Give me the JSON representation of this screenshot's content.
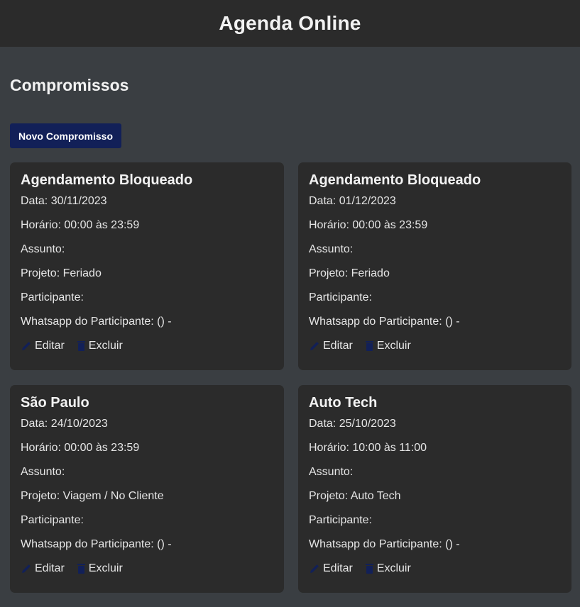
{
  "header": {
    "title": "Agenda Online"
  },
  "page": {
    "title": "Compromissos",
    "new_button": "Novo Compromisso"
  },
  "labels": {
    "edit": "Editar",
    "delete": "Excluir"
  },
  "icons": {
    "edit": "pencil-icon",
    "delete": "trash-icon",
    "icon_color": "#122058"
  },
  "cards": [
    {
      "title": "Agendamento Bloqueado",
      "data": "Data: 30/11/2023",
      "horario": "Horário: 00:00 às 23:59",
      "assunto": "Assunto:",
      "projeto": "Projeto: Feriado",
      "participante": "Participante:",
      "whatsapp": "Whatsapp do Participante: () -"
    },
    {
      "title": "Agendamento Bloqueado",
      "data": "Data: 01/12/2023",
      "horario": "Horário: 00:00 às 23:59",
      "assunto": "Assunto:",
      "projeto": "Projeto: Feriado",
      "participante": "Participante:",
      "whatsapp": "Whatsapp do Participante: () -"
    },
    {
      "title": "São Paulo",
      "data": "Data: 24/10/2023",
      "horario": "Horário: 00:00 às 23:59",
      "assunto": "Assunto:",
      "projeto": "Projeto: Viagem / No Cliente",
      "participante": "Participante:",
      "whatsapp": "Whatsapp do Participante: () -"
    },
    {
      "title": "Auto Tech",
      "data": "Data: 25/10/2023",
      "horario": "Horário: 10:00 às 11:00",
      "assunto": "Assunto:",
      "projeto": "Projeto: Auto Tech",
      "participante": "Participante:",
      "whatsapp": "Whatsapp do Participante: () -"
    }
  ]
}
